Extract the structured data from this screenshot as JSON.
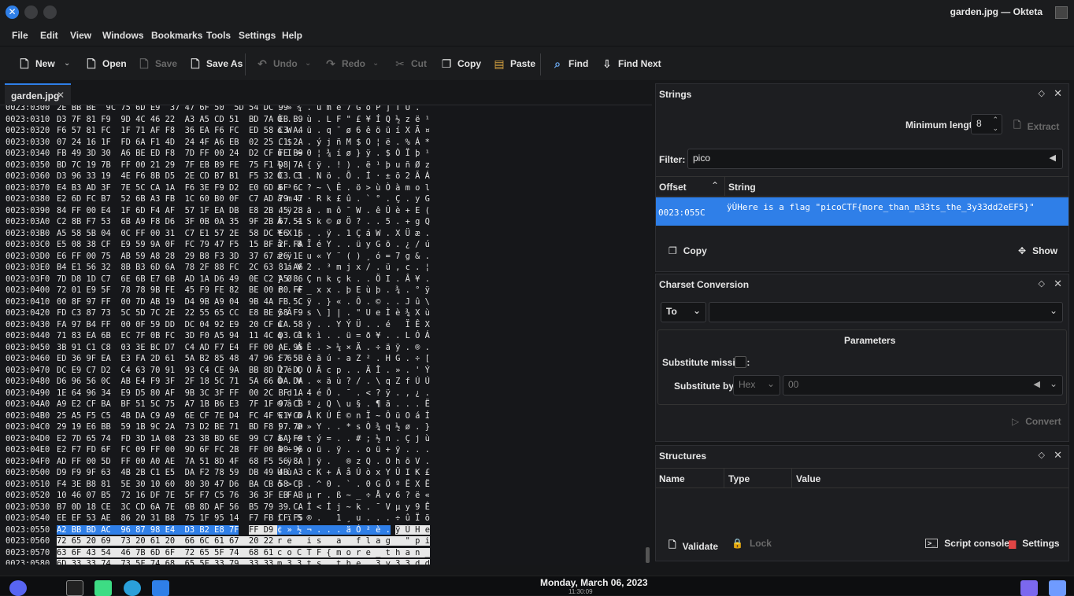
{
  "window": {
    "title": "garden.jpg — Okteta"
  },
  "menu": [
    "File",
    "Edit",
    "View",
    "Windows",
    "Bookmarks",
    "Tools",
    "Settings",
    "Help"
  ],
  "toolbar": {
    "new": "New",
    "open": "Open",
    "save": "Save",
    "save_as": "Save As",
    "undo": "Undo",
    "redo": "Redo",
    "cut": "Cut",
    "copy": "Copy",
    "paste": "Paste",
    "find": "Find",
    "find_next": "Find Next"
  },
  "tab": {
    "label": "garden.jpg"
  },
  "hex_rows": [
    {
      "off": "0023:0300",
      "hex": "2E BB BE  9C 75 6D E9  37 47 6F 50  5D 54 DC 99",
      "chr": ". » ¾ . u m é 7 G o P ] T Ü ."
    },
    {
      "off": "0023:0310",
      "hex": "D3 7F 81 F9  9D 4C 46 22  A3 A5 CD 51  BD 7A EB B9",
      "chr": "Ó . . ù . L F \" £ ¥ Í Q ½ z ë ¹"
    },
    {
      "off": "0023:0320",
      "hex": "F6 57 81 FC  1F 71 AF F8  36 EA F6 FC  ED 58 C3 A4",
      "chr": "ö W . ü . q ¯ ø 6 ê ö ü í X Ã ¤"
    },
    {
      "off": "0023:0330",
      "hex": "07 24 16 1F  FD 6A F1 4D  24 4F A6 EB  02 25 C1 2A",
      "chr": ". $ . . ý j ñ M $ O ¦ ë . % Á *"
    },
    {
      "off": "0023:0340",
      "hex": "FB 49 3D 30  A6 BE ED F8  7D FF 00 24  D2 CF FE B9",
      "chr": "û I = 0 ¦ ¾ í ø } ÿ . $ Ò Ï þ ¹"
    },
    {
      "off": "0023:0350",
      "hex": "BD 7C 19 7B  FF 00 21 29  7F EB B9 FE  75 F1 D8 7A",
      "chr": "½ | . { ÿ . ! ) . ë ¹ þ u ñ Ø z"
    },
    {
      "off": "0023:0360",
      "hex": "D3 96 33 19  4E F6 8B D5  2E CD B7 B1  F5 32 C3 C1",
      "chr": "Ó . 3 . N ö . Õ . Í · ± õ 2 Ã Á"
    },
    {
      "off": "0023:0370",
      "hex": "E4 B3 AD 3F  7E 5C CA 1A  F6 3E F9 D2  E0 6D 6F 6C",
      "chr": "ä ³ . ? ~ \\ Ê . ö > ù Ò à m o l"
    },
    {
      "off": "0023:0380",
      "hex": "E2 6D FC B7  52 6B A3 FB  1C 60 B0 0F  C7 AD 79 47",
      "chr": "â m ü · R k £ û . ` ° . Ç . y G"
    },
    {
      "off": "0023:0390",
      "hex": "84 FF 00 E4  1F 6D F4 AF  57 1F EA DB  E8 2B 45 28",
      "chr": ". ÿ . ä . m ô ¯ W . ê Û è + E ("
    },
    {
      "off": "0023:03A0",
      "hex": "C2 8B F7 53  6B A9 F8 D6  3F 0B 0A 35  9F 2B 67 51",
      "chr": "Â . ÷ S k © ø Ö ? . . 5 . + g Q"
    },
    {
      "off": "0023:03B0",
      "hex": "A5 58 5B 04  0C FF 00 31  C7 E1 57 2E  58 DC E6 16",
      "chr": "¥ X [ . . ÿ . 1 Ç á W . X Ü æ ."
    },
    {
      "off": "0023:03C0",
      "hex": "E5 08 38 CF  E9 59 9A 0F  FC 79 47 F5  15 BF 2F FA",
      "chr": "å . 8 Ï é Y . . ü y G õ . ¿ / ú"
    },
    {
      "off": "0023:03D0",
      "hex": "E6 FF 00 75  AB 59 A8 28  29 B8 F3 3D  37 67 26 1E",
      "chr": "æ ÿ . u « Y ¨ ( ) ¸ ó = 7 g & ."
    },
    {
      "off": "0023:03E0",
      "hex": "B4 E1 56 32  8B B3 6D 6A  78 2F 88 FC  2C 63 81 A6",
      "chr": "´ á V 2 . ³ m j x / . ü , c . ¦"
    },
    {
      "off": "0023:03F0",
      "hex": "7D D8 1D C7  6E 6B E7 6B  AD 1A D6 49  0E C2 A5 86",
      "chr": "} Ø . Ç n k ç k . . Ö I . Â ¥ ."
    },
    {
      "off": "0023:0400",
      "hex": "72 01 E9 5F  78 78 9B FE  45 F9 FE 82  BE 00 B0 FF",
      "chr": "r . é _ x x . þ E ù þ . ¾ . ° ÿ"
    },
    {
      "off": "0023:0410",
      "hex": "00 8F 97 FF  00 7D AB 19  D4 9B A9 04  9B 4A FB 5C",
      "chr": ". . . ÿ . } « . Ô . © . . J û \\"
    },
    {
      "off": "0023:0420",
      "hex": "FD C3 87 73  5C 5D 7C 2E  22 55 65 CC  E8 BE 58 F9",
      "chr": "ý Ã . s \\ ] | . \" U e Ì è ¾ X ù"
    },
    {
      "off": "0023:0430",
      "hex": "FA 97 B4 FF  00 0F 59 DD  DC 04 92 E9  20 CF CA 58",
      "chr": "ú . ´ ÿ . . Y Ý Ü . . é   Ï Ê X"
    },
    {
      "off": "0023:0440",
      "hex": "71 83 EA 6B  EC 7F 0B FC  3D F0 A5 94  11 4C D3 C1",
      "chr": "q . ê k ì . . ü = ð ¥ . . L Ó Á"
    },
    {
      "off": "0023:0450",
      "hex": "3B 91 C1 C8  03 3E BC D7  C4 AD F7 E4  FF 00 AE 95",
      "chr": "; . Á È . > ¼ × Ä . ÷ ä ÿ . ® ."
    },
    {
      "off": "0023:0460",
      "hex": "ED 36 9F EA  E3 FA 2D 61  5A B2 85 48  47 96 F7 5B",
      "chr": "í 6 . ê ã ú - a Z ² . H G . ÷ ["
    },
    {
      "off": "0023:0470",
      "hex": "DC E9 C7 D2  C4 63 70 91  93 C4 CE 9A  BB 8D 27 DD",
      "chr": "Ü é Ç Ò Ä c p . . Ä Î . » . ' Ý"
    },
    {
      "off": "0023:0480",
      "hex": "D6 96 56 0C  AB E4 F9 3F  2F 18 5C 71  5A 66 DA DA",
      "chr": "Ö . V . « ä ù ? / . \\ q Z f Ú Ú"
    },
    {
      "off": "0023:0490",
      "hex": "1E 64 96 34  E9 D5 80 AF  9B 3C 3F FF  00 2C BF 1A",
      "chr": ". d . 4 é Õ . ¯ . < ? ÿ . , ¿ ."
    },
    {
      "off": "0023:04A0",
      "hex": "A9 E2 CF BA  BF 51 5C 75  A7 1B B6 E3  7F 1F 97 CB",
      "chr": "© â Ï º ¿ Q \\ u § . ¶ ã . . . Ë"
    },
    {
      "off": "0023:04B0",
      "hex": "25 A5 F5 C5  4B DA C9 A9  6E CF 7E D4  FC 4F E1 CD",
      "chr": "% ¥ õ Å K Ú É © n Ï ~ Ô ü O á Í"
    },
    {
      "off": "0023:04C0",
      "hex": "29 19 E6 BB  59 1B 9C 2A  73 D2 BE 71  BD F8 97 7D",
      "chr": ") . æ » Y . . * s Ò ¾ q ½ ø . }"
    },
    {
      "off": "0023:04D0",
      "hex": "E2 7D 65 74  FD 3D 1A 08  23 3B BD 6E  99 C7 6A F9",
      "chr": "â } e t ý = . . # ; ½ n . Ç j ù"
    },
    {
      "off": "0023:04E0",
      "hex": "E2 F7 FD 6F  FC 09 FF 00  9D 6F FC 2B  FF 00 90 96",
      "chr": "â ÷ ý o ü . ÿ . . o ü + ÿ . . ."
    },
    {
      "off": "0023:04F0",
      "hex": "AD FF 00 5D  FF 00 A0 AE  7A 51 8D 4F  68 F5 56 8A",
      "chr": ". ÿ . ] ÿ .   ® z Q . O h õ V ."
    },
    {
      "off": "0023:0500",
      "hex": "D9 F9 9F 63  4B 2B C1 E5  DA F2 78 59  DB 49 4B A3",
      "chr": "Ù ù . c K + Á å Ú ò x Y Û I K £"
    },
    {
      "off": "0023:0510",
      "hex": "F4 3E B8 81  5E 30 10 60  80 30 47 D6  BA CB 58 CB",
      "chr": "ô > ¸ . ^ 0 . ` . 0 G Ö º Ë X Ë"
    },
    {
      "off": "0023:0520",
      "hex": "10 46 07 B5  72 16 DF 7E  5F F7 C5 76  36 3F EB AB",
      "chr": ". F . µ r . ß ~ _ ÷ Å v 6 ? ë «"
    },
    {
      "off": "0023:0530",
      "hex": "B7 0D 18 CE  3C CD 6A 7E  6B 8D AF 56  B5 79 39 CA",
      "chr": "· . . Î < Í j ~ k . ¯ V µ y 9 Ê"
    },
    {
      "off": "0023:0540",
      "hex": "EE EF 53 AE  86 20 31 B8  75 1F 95 14  F7 FB CF F5",
      "chr": "î ï S ® .   1 ¸ u . . . ÷ û Ï õ"
    }
  ],
  "hex_rows_selected": [
    {
      "off": "0023:0550",
      "hexA": "A2 BB BD AC  96 87 98 E4  D3 B2 E8 7F",
      "hexB": "FF D9 48 65",
      "chrA": "¢ » ½ ¬ . . . ä Ó ² è .",
      "chrB": "ÿ Ù H e"
    },
    {
      "off": "0023:0560",
      "hexA": "",
      "hexB": "72 65 20 69  73 20 61 20  66 6C 61 67  20 22 70 69",
      "chrA": "",
      "chrB": "r e   i s   a   f l a g   \" p i"
    },
    {
      "off": "0023:0570",
      "hexA": "",
      "hexB": "63 6F 43 54  46 7B 6D 6F  72 65 5F 74  68 61 6E 5F",
      "chrA": "",
      "chrB": "c o C T F { m o r e _ t h a n _"
    },
    {
      "off": "0023:0580",
      "hexA": "",
      "hexB": "6D 33 33 74  73 5F 74 68  65 5F 33 79  33 33 64 64",
      "chrA": "",
      "chrB": "m 3 3 t s _ t h e _ 3 y 3 3 d d"
    },
    {
      "off": "0023:0590",
      "hexA": "",
      "hexB": "32 65 45 46  35 7D 22 0A",
      "chrA": "",
      "chrB": "2 e E F 5 } \" ."
    }
  ],
  "strings_panel": {
    "title": "Strings",
    "min_length_label": "Minimum length:",
    "min_length_value": "8",
    "extract": "Extract",
    "filter_label": "Filter:",
    "filter_value": "pico",
    "col_offset": "Offset",
    "col_string": "String",
    "result_offset": "0023:055C",
    "result_string": "ÿÙHere is a flag \"picoCTF{more_than_m33ts_the_3y33dd2eEF5}\"",
    "copy": "Copy",
    "show": "Show"
  },
  "charset_panel": {
    "title": "Charset Conversion",
    "direction": "To",
    "params_title": "Parameters",
    "sub_missing_label": "Substitute missing:",
    "sub_byte_label": "Substitute byte:",
    "sub_byte_format": "Hex",
    "sub_byte_value": "00",
    "convert": "Convert"
  },
  "structures_panel": {
    "title": "Structures",
    "col_name": "Name",
    "col_type": "Type",
    "col_value": "Value",
    "validate": "Validate",
    "lock": "Lock",
    "script_console": "Script console",
    "settings": "Settings"
  },
  "taskbar": {
    "date": "Monday, March 06, 2023",
    "time": "11:30:09"
  },
  "colors": {
    "accent": "#2f7fe8",
    "selection": "#2f7fe8",
    "background": "#161719"
  }
}
